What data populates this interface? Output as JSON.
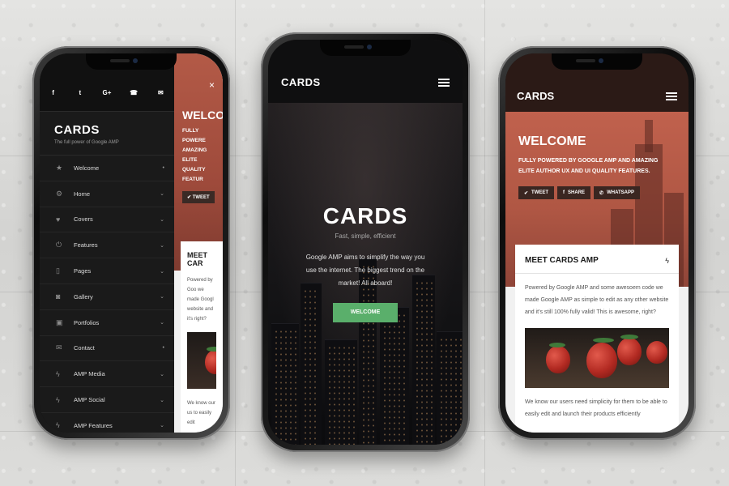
{
  "phone1": {
    "social_icons": [
      "f",
      "t",
      "G+",
      "☎",
      "✉"
    ],
    "brand_title": "CARDS",
    "brand_subtitle": "The full power of Google AMP",
    "close_label": "×",
    "menu": [
      {
        "icon": "★",
        "icon_name": "star-icon",
        "label": "Welcome",
        "chevron": "•"
      },
      {
        "icon": "⚙",
        "icon_name": "gear-icon",
        "label": "Home",
        "chevron": "⌄"
      },
      {
        "icon": "♥",
        "icon_name": "heart-icon",
        "label": "Covers",
        "chevron": "⌄"
      },
      {
        "icon": "⏻",
        "icon_name": "power-icon",
        "label": "Features",
        "chevron": "⌄"
      },
      {
        "icon": "▯",
        "icon_name": "page-icon",
        "label": "Pages",
        "chevron": "⌄"
      },
      {
        "icon": "◙",
        "icon_name": "camera-icon",
        "label": "Gallery",
        "chevron": "⌄"
      },
      {
        "icon": "▣",
        "icon_name": "image-icon",
        "label": "Portfolios",
        "chevron": "⌄"
      },
      {
        "icon": "✉",
        "icon_name": "envelope-icon",
        "label": "Contact",
        "chevron": "•"
      },
      {
        "icon": "ϟ",
        "icon_name": "bolt-icon",
        "label": "AMP Media",
        "chevron": "⌄"
      },
      {
        "icon": "ϟ",
        "icon_name": "bolt-icon",
        "label": "AMP Social",
        "chevron": "⌄"
      },
      {
        "icon": "ϟ",
        "icon_name": "bolt-icon",
        "label": "AMP Features",
        "chevron": "⌄"
      }
    ],
    "hero_title": "WELCO",
    "hero_text": "FULLY POWERE AMAZING ELITE QUALITY FEATUR",
    "tweet_label": "✔ TWEET",
    "card_title": "MEET CAR",
    "card_text": "Powered by Goo we made Googl website and it's right?",
    "card_more": "We know our us to easily edit"
  },
  "phone2": {
    "logo": "CARDS",
    "title": "CARDS",
    "tagline": "Fast, simple, efficient",
    "description": "Google AMP aims to simplify the way you use the internet. The biggest trend on the market! All aboard!",
    "button_label": "WELCOME"
  },
  "phone3": {
    "logo": "CARDS",
    "hero_title": "WELCOME",
    "hero_text": "FULLY POWERED BY GOOGLE AMP AND AMAZING ELITE AUTHOR UX AND UI QUALITY FEATURES.",
    "share_buttons": [
      {
        "icon": "✔",
        "icon_name": "twitter-icon",
        "label": "TWEET"
      },
      {
        "icon": "f",
        "icon_name": "facebook-icon",
        "label": "SHARE"
      },
      {
        "icon": "✆",
        "icon_name": "whatsapp-icon",
        "label": "WHATSAPP"
      }
    ],
    "card_title": "MEET CARDS AMP",
    "card_icon": "ϟ",
    "card_text": "Powered by Google AMP and some awesoem code we made Google AMP as simple to edit as any other website and it's still 100% fully valid! This is awesome, right?",
    "card_more": "We know our users need simplicity for them to be able to easily edit and launch their products efficiently"
  },
  "colors": {
    "background_wall": "#d9d9d7",
    "hero_red": "#b35a47",
    "sidebar_dark": "#1a1a1a",
    "welcome_button_green": "#5aaf6b"
  }
}
